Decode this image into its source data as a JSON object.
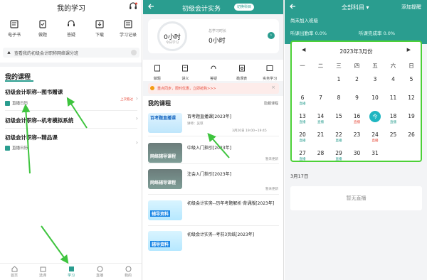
{
  "panel1": {
    "title": "我的学习",
    "shortcuts": [
      {
        "label": "电子书",
        "icon": "ebook-icon"
      },
      {
        "label": "做题",
        "icon": "exercise-icon"
      },
      {
        "label": "答疑",
        "icon": "qa-icon"
      },
      {
        "label": "下载",
        "icon": "download-icon"
      },
      {
        "label": "学习记录",
        "icon": "study-record-icon"
      }
    ],
    "notice": "查看我的初级会计职称网络课分班",
    "my_courses": "我的课程",
    "courses": [
      {
        "title": "初级会计职称--图书赠课",
        "sub": "直播日历",
        "badge": "上次看过"
      },
      {
        "title": "初级会计职称--机考模拟系统",
        "sub": ""
      },
      {
        "title": "初级会计职称--精品课",
        "sub": "直播日历"
      }
    ],
    "tabs": [
      "首页",
      "选课",
      "学习",
      "直播",
      "我的"
    ]
  },
  "panel2": {
    "title": "初级会计实务",
    "pill": "切换科目",
    "today_val": "0小时",
    "today_label": "今日学习",
    "total_label": "总学习时长",
    "total_val": "0小时",
    "icons": [
      "做题",
      "讲义",
      "答疑",
      "勘误表",
      "实务学习"
    ],
    "promo": "重点同步，限时优惠，立即抢购>>>",
    "my_courses": "我的课程",
    "hide": "隐藏课程",
    "items": [
      {
        "title": "百考题直播课[2023年]",
        "teacher": "讲师：吴琼",
        "time": "3月20日 19:00~19:45",
        "thumb": "百考题直播课"
      },
      {
        "title": "中级入门指引[2023年]",
        "status": "暂未更新",
        "thumb": "网络辅导课程"
      },
      {
        "title": "注会入门指引[2023年]",
        "status": "暂未更新",
        "thumb": "网络辅导课程"
      },
      {
        "title": "初级会计实务--历年考题解析·背诵版[2023年]",
        "thumb": "辅导资料"
      },
      {
        "title": "初级会计实务--考前3页纸[2023年]",
        "thumb": "辅导资料"
      }
    ]
  },
  "panel3": {
    "subject": "全部科目",
    "add": "添加提醒",
    "no_class": "尚未加入班级",
    "rate1": "听课出勤率 0.0%",
    "rate2": "听课完成率 0.0%",
    "month": "2023年3月份",
    "weekdays": [
      "一",
      "二",
      "三",
      "四",
      "五",
      "六",
      "日"
    ],
    "days": [
      [
        "",
        "",
        "1",
        "2",
        "3",
        "4",
        "5"
      ],
      [
        "6",
        "7",
        "8",
        "9",
        "10",
        "11",
        "12"
      ],
      [
        "13",
        "14",
        "15",
        "16",
        "17",
        "18",
        "19"
      ],
      [
        "20",
        "21",
        "22",
        "23",
        "24",
        "25",
        "26"
      ],
      [
        "27",
        "28",
        "29",
        "30",
        "31",
        "",
        ""
      ]
    ],
    "tags": {
      "6": "直播",
      "13": "直播",
      "14": "直播",
      "16": "直播",
      "18": "直播",
      "20": "直播",
      "22": "直播",
      "24": "直播",
      "27": "直播",
      "29": "直播"
    },
    "today": "17",
    "today_label": "今",
    "selected_date": "3月17日",
    "no_live": "暂无直播"
  },
  "colors": {
    "primary": "#2a9d8f",
    "accent_green": "#4cd137",
    "live_red": "#e74c3c"
  }
}
